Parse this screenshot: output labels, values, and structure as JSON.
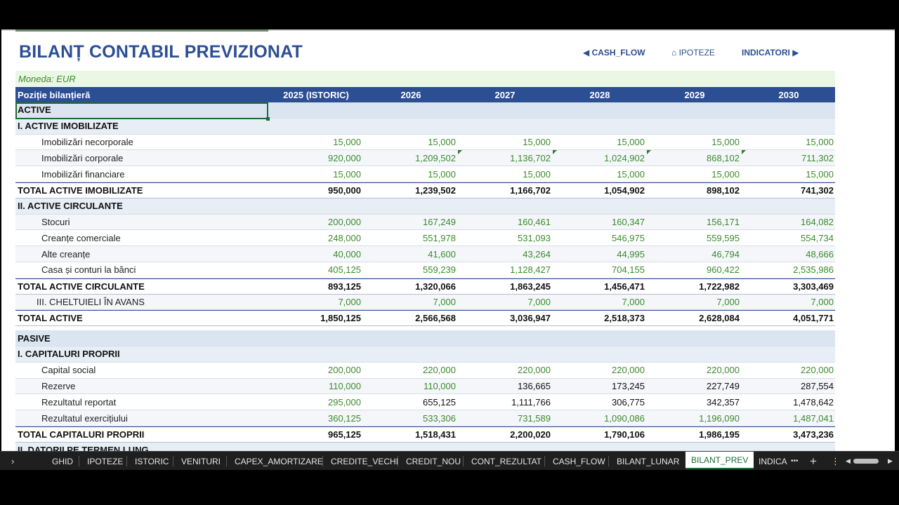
{
  "title": "BILANȚ CONTABIL PREVIZIONAT",
  "nav": {
    "cash_flow": "◀ CASH_FLOW",
    "ipoteze": "⌂ IPOTEZE",
    "indicatori": "INDICATORI ▶"
  },
  "currency": "Moneda: EUR",
  "header": {
    "label": "Poziție bilanțieră",
    "years": [
      "2025 (ISTORIC)",
      "2026",
      "2027",
      "2028",
      "2029",
      "2030"
    ]
  },
  "rows": [
    {
      "type": "sec",
      "label": "ACTIVE"
    },
    {
      "type": "sub",
      "label": "I. ACTIVE IMOBILIZATE"
    },
    {
      "type": "item",
      "label": "Imobilizări necorporale",
      "values": [
        "15,000",
        "15,000",
        "15,000",
        "15,000",
        "15,000",
        "15,000"
      ],
      "colors": [
        "g",
        "g",
        "g",
        "g",
        "g",
        "g"
      ]
    },
    {
      "type": "item",
      "label": "Imobilizări corporale",
      "values": [
        "920,000",
        "1,209,502",
        "1,136,702",
        "1,024,902",
        "868,102",
        "711,302"
      ],
      "colors": [
        "g",
        "g",
        "g",
        "g",
        "g",
        "g"
      ],
      "flags": [
        false,
        true,
        true,
        true,
        true,
        false
      ]
    },
    {
      "type": "item",
      "label": "Imobilizări financiare",
      "values": [
        "15,000",
        "15,000",
        "15,000",
        "15,000",
        "15,000",
        "15,000"
      ],
      "colors": [
        "g",
        "g",
        "g",
        "g",
        "g",
        "g"
      ]
    },
    {
      "type": "total",
      "label": "TOTAL ACTIVE IMOBILIZATE",
      "values": [
        "950,000",
        "1,239,502",
        "1,166,702",
        "1,054,902",
        "898,102",
        "741,302"
      ]
    },
    {
      "type": "sub",
      "label": "II. ACTIVE CIRCULANTE"
    },
    {
      "type": "item",
      "label": "Stocuri",
      "values": [
        "200,000",
        "167,249",
        "160,461",
        "160,347",
        "156,171",
        "164,082"
      ],
      "colors": [
        "g",
        "g",
        "g",
        "g",
        "g",
        "g"
      ]
    },
    {
      "type": "item",
      "label": "Creanțe comerciale",
      "values": [
        "248,000",
        "551,978",
        "531,093",
        "546,975",
        "559,595",
        "554,734"
      ],
      "colors": [
        "g",
        "g",
        "g",
        "g",
        "g",
        "g"
      ]
    },
    {
      "type": "item",
      "label": "Alte creanțe",
      "values": [
        "40,000",
        "41,600",
        "43,264",
        "44,995",
        "46,794",
        "48,666"
      ],
      "colors": [
        "g",
        "g",
        "g",
        "g",
        "g",
        "g"
      ]
    },
    {
      "type": "item",
      "label": "Casa și conturi la bănci",
      "values": [
        "405,125",
        "559,239",
        "1,128,427",
        "704,155",
        "960,422",
        "2,535,986"
      ],
      "colors": [
        "g",
        "g",
        "g",
        "g",
        "g",
        "g"
      ]
    },
    {
      "type": "total",
      "label": "TOTAL ACTIVE CIRCULANTE",
      "values": [
        "893,125",
        "1,320,066",
        "1,863,245",
        "1,456,471",
        "1,722,982",
        "3,303,469"
      ]
    },
    {
      "type": "item2",
      "label": "III. CHELTUIELI ÎN AVANS",
      "values": [
        "7,000",
        "7,000",
        "7,000",
        "7,000",
        "7,000",
        "7,000"
      ],
      "colors": [
        "g",
        "g",
        "g",
        "g",
        "g",
        "g"
      ]
    },
    {
      "type": "total",
      "label": "TOTAL ACTIVE",
      "values": [
        "1,850,125",
        "2,566,568",
        "3,036,947",
        "2,518,373",
        "2,628,084",
        "4,051,771"
      ]
    },
    {
      "type": "gap"
    },
    {
      "type": "sec",
      "label": "PASIVE"
    },
    {
      "type": "sub",
      "label": "I. CAPITALURI PROPRII"
    },
    {
      "type": "item",
      "label": "Capital social",
      "values": [
        "200,000",
        "220,000",
        "220,000",
        "220,000",
        "220,000",
        "220,000"
      ],
      "colors": [
        "g",
        "g",
        "g",
        "g",
        "g",
        "g"
      ]
    },
    {
      "type": "item",
      "label": "Rezerve",
      "values": [
        "110,000",
        "110,000",
        "136,665",
        "173,245",
        "227,749",
        "287,554"
      ],
      "colors": [
        "g",
        "g",
        "k",
        "k",
        "k",
        "k"
      ]
    },
    {
      "type": "item",
      "label": "Rezultatul reportat",
      "values": [
        "295,000",
        "655,125",
        "1,111,766",
        "306,775",
        "342,357",
        "1,478,642"
      ],
      "colors": [
        "g",
        "k",
        "k",
        "k",
        "k",
        "k"
      ]
    },
    {
      "type": "item",
      "label": "Rezultatul exercițiului",
      "values": [
        "360,125",
        "533,306",
        "731,589",
        "1,090,086",
        "1,196,090",
        "1,487,041"
      ],
      "colors": [
        "g",
        "g",
        "g",
        "g",
        "g",
        "g"
      ]
    },
    {
      "type": "total",
      "label": "TOTAL CAPITALURI PROPRII",
      "values": [
        "965,125",
        "1,518,431",
        "2,200,020",
        "1,790,106",
        "1,986,195",
        "3,473,236"
      ]
    },
    {
      "type": "sub",
      "label": "II. DATORII PE TERMEN LUNG"
    }
  ],
  "tabs": [
    {
      "label": "GHID"
    },
    {
      "label": "IPOTEZE"
    },
    {
      "label": "ISTORIC"
    },
    {
      "label": "VENITURI"
    },
    {
      "label": "CAPEX_AMORTIZARE"
    },
    {
      "label": "CREDITE_VECHI"
    },
    {
      "label": "CREDIT_NOU"
    },
    {
      "label": "CONT_REZULTAT"
    },
    {
      "label": "CASH_FLOW"
    },
    {
      "label": "BILANT_LUNAR"
    },
    {
      "label": "BILANT_PREV",
      "active": true
    },
    {
      "label": "INDICA"
    }
  ],
  "tab_controls": {
    "prev": "›",
    "more": "•••",
    "add": "+",
    "menu": "⋮",
    "scroll_left": "◀",
    "scroll_right": "▶"
  }
}
